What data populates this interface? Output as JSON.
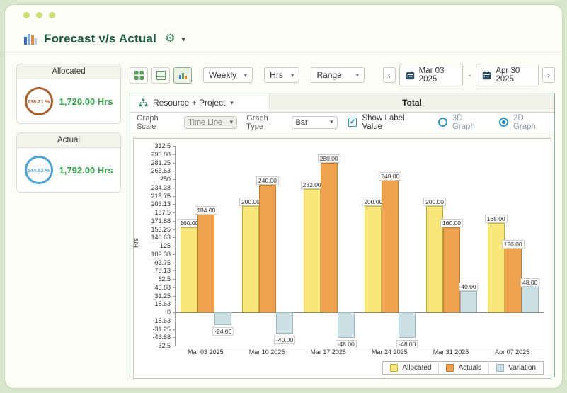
{
  "window": {
    "title": "Forecast v/s Actual"
  },
  "sidebar": {
    "cards": [
      {
        "header": "Allocated",
        "percent": "138.71 %",
        "hours": "1,720.00 Hrs",
        "ring_color": "#a9602f"
      },
      {
        "header": "Actual",
        "percent": "144.52 %",
        "hours": "1,792.00 Hrs",
        "ring_color": "#4ba3d8"
      }
    ],
    "hours_color": "#2f9e44"
  },
  "toolbar": {
    "frequency": "Weekly",
    "unit": "Hrs",
    "range": "Range",
    "prev": "‹",
    "next": "›",
    "date_from": "Mar 03 2025",
    "date_separator": "-",
    "date_to": "Apr 30 2025"
  },
  "panel": {
    "group_by": "Resource + Project",
    "total": "Total",
    "graph_scale_label": "Graph Scale",
    "graph_scale_value": "Time Line",
    "graph_type_label": "Graph Type",
    "graph_type_value": "Bar",
    "show_label_value": "Show Label Value",
    "graph_3d": "3D Graph",
    "graph_2d": "2D Graph"
  },
  "chart_data": {
    "type": "bar",
    "ylabel": "Hrs",
    "ylim": [
      -62.5,
      312.5
    ],
    "yticks": [
      "312.5",
      "296.88",
      "281.25",
      "265.63",
      "250",
      "234.38",
      "218.75",
      "203.13",
      "187.5",
      "171.88",
      "156.25",
      "140.63",
      "125",
      "109.38",
      "93.75",
      "78.13",
      "62.5",
      "46.88",
      "31.25",
      "15.63",
      "0",
      "-15.63",
      "-31.25",
      "-46.88",
      "-62.5"
    ],
    "categories": [
      "Mar 03 2025",
      "Mar 10 2025",
      "Mar 17 2025",
      "Mar 24 2025",
      "Mar 31 2025",
      "Apr 07 2025"
    ],
    "series": [
      {
        "name": "Allocated",
        "fill": "#f9e77c",
        "stroke": "#c5ae3d",
        "values": [
          160,
          200,
          232,
          200,
          200,
          168
        ]
      },
      {
        "name": "Actuals",
        "fill": "#efa350",
        "stroke": "#c1802f",
        "values": [
          184,
          240,
          280,
          248,
          160,
          120
        ]
      },
      {
        "name": "Variation",
        "fill": "#ccdfe5",
        "stroke": "#9db9c0",
        "values": [
          -24,
          -40,
          -48,
          -48,
          40,
          48
        ]
      }
    ],
    "value_label_format": "two_decimals",
    "legend_position": "bottom-right",
    "grid": false
  }
}
